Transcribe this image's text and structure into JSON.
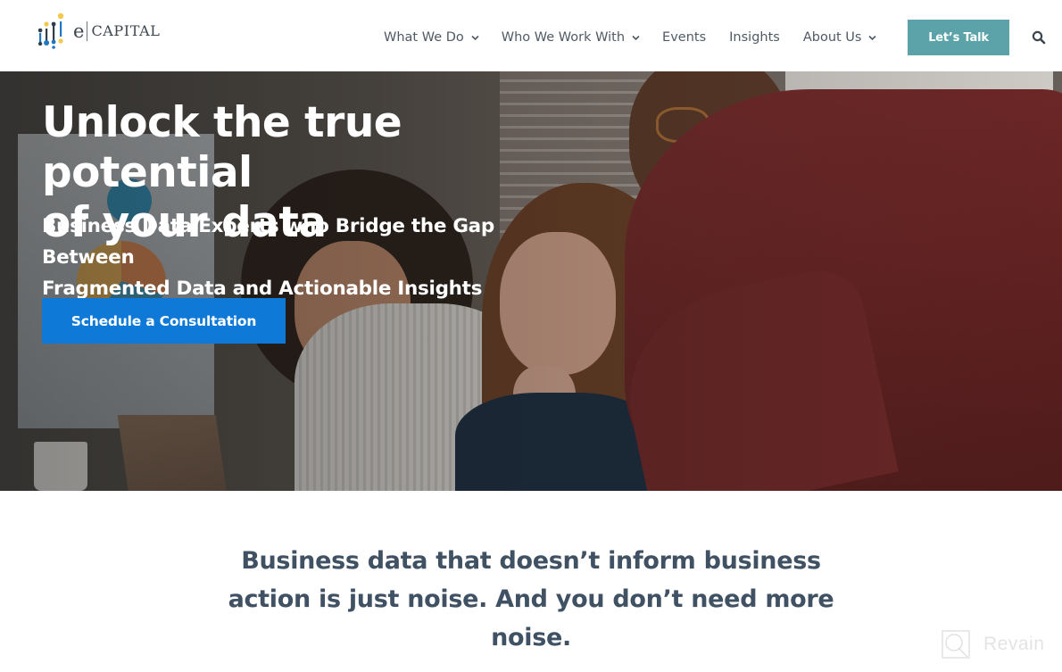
{
  "header": {
    "logo": {
      "prefix": "e",
      "name": "CAPITAL",
      "colors": {
        "navy": "#2f3d4c",
        "blue": "#1f78c1",
        "gold": "#f2c94c"
      }
    },
    "nav": [
      {
        "label": "What We Do",
        "has_dropdown": true
      },
      {
        "label": "Who We Work With",
        "has_dropdown": true
      },
      {
        "label": "Events",
        "has_dropdown": false
      },
      {
        "label": "Insights",
        "has_dropdown": false
      },
      {
        "label": "About Us",
        "has_dropdown": true
      }
    ],
    "cta_label": "Let’s Talk",
    "cta_color": "#5ba3a9",
    "search_icon": "search-icon"
  },
  "hero": {
    "title_line1": "Unlock the true potential",
    "title_line2": "of your data",
    "subtitle_line1": "Business Data Experts who Bridge the Gap Between",
    "subtitle_line2": "Fragmented Data and Actionable Insights",
    "cta_label": "Schedule a Consultation",
    "cta_color": "#0f79d8",
    "image_alt": "Three colleagues smiling while looking at a laptop in an office"
  },
  "statement": {
    "line1": "Business data that doesn’t inform business",
    "line2": "action is just noise. And you don’t need more",
    "line3": "noise.",
    "color": "#3f5163"
  },
  "watermark": {
    "label": "Revain"
  }
}
